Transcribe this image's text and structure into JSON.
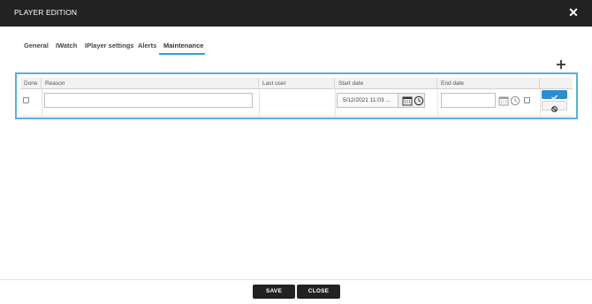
{
  "dialog": {
    "title": "PLAYER EDITION",
    "close_icon": "close-icon"
  },
  "tabs": [
    {
      "label": "General"
    },
    {
      "label": "IWatch"
    },
    {
      "label": "IPlayer settings"
    },
    {
      "label": "Alerts"
    },
    {
      "label": "Maintenance",
      "active": true
    }
  ],
  "toolbar": {
    "add_icon": "plus-icon"
  },
  "table": {
    "columns": [
      "Done",
      "Reason",
      "Last user",
      "Start date",
      "End date",
      ""
    ],
    "rows": [
      {
        "done": false,
        "reason": "",
        "last_user": "",
        "start_date": "5/12/2021 11:03 ...",
        "end_date": "",
        "end_enabled": false
      }
    ]
  },
  "footer": {
    "save_label": "SAVE",
    "close_label": "CLOSE"
  },
  "colors": {
    "titlebar": "#222222",
    "accent": "#29a3d6",
    "frame": "#5aaed9",
    "validate": "#2c8dd1"
  }
}
